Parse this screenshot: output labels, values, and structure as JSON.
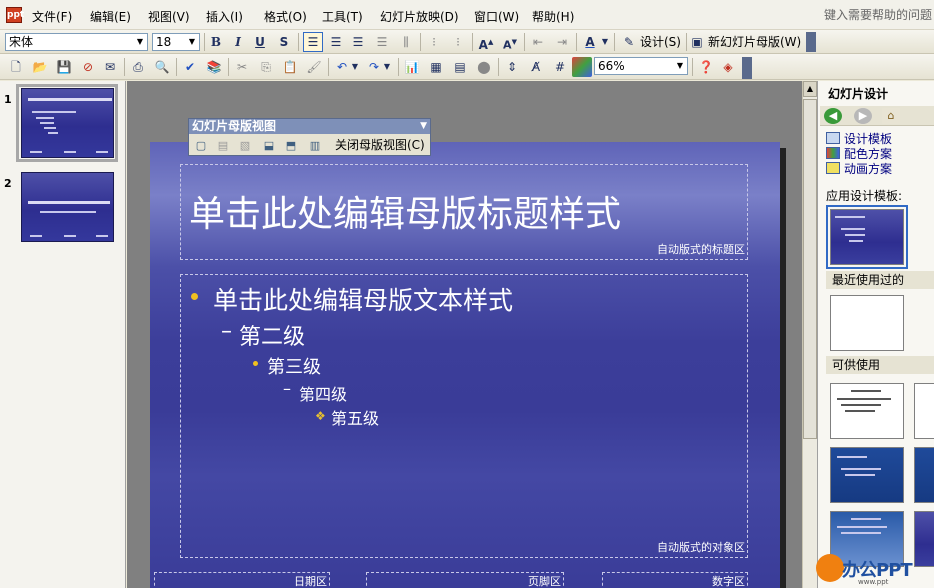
{
  "menu": {
    "app_icon": "ppt",
    "items": [
      "文件(F)",
      "编辑(E)",
      "视图(V)",
      "插入(I)",
      "格式(O)",
      "工具(T)",
      "幻灯片放映(D)",
      "窗口(W)",
      "帮助(H)"
    ],
    "help_placeholder": "键入需要帮助的问题"
  },
  "format_toolbar": {
    "font_name": "宋体",
    "font_size": "18",
    "bold": "B",
    "italic": "I",
    "underline": "U",
    "shadow": "S",
    "font_color_label": "A",
    "design_label": "设计(S)",
    "new_master_label": "新幻灯片母版(W)"
  },
  "standard_toolbar": {
    "zoom": "66%"
  },
  "slides_pane": {
    "slide_numbers": [
      "1",
      "2"
    ]
  },
  "master_view_toolbar": {
    "title": "幻灯片母版视图",
    "close_label": "关闭母版视图(C)"
  },
  "slide": {
    "title": "单击此处编辑母版标题样式",
    "title_area_label": "自动版式的标题区",
    "levels": [
      "单击此处编辑母版文本样式",
      "第二级",
      "第三级",
      "第四级",
      "第五级"
    ],
    "dash": "–",
    "diamond": "❖",
    "object_area_label": "自动版式的对象区",
    "date_area_label": "日期区",
    "footer_area_label": "页脚区",
    "number_area_label": "数字区"
  },
  "task_pane": {
    "title": "幻灯片设计",
    "links": [
      "设计模板",
      "配色方案",
      "动画方案"
    ],
    "apply_label": "应用设计模板:",
    "recent_label": "最近使用过的",
    "available_label": "可供使用"
  },
  "watermark": {
    "text": "办公PPT",
    "sub": "www.ppt"
  },
  "colors": {
    "accent": "#316ac5",
    "slide_bg": "#3c3e9a",
    "bullet": "#f0c020"
  }
}
